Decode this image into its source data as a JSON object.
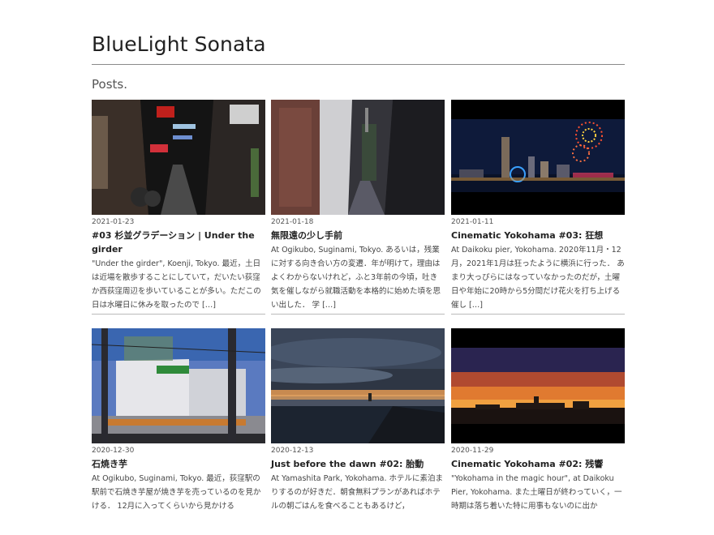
{
  "site": {
    "title": "BlueLight Sonata"
  },
  "section": {
    "heading": "Posts."
  },
  "posts": [
    {
      "date": "2021-01-23",
      "title": "#03 杉並グラデーション | Under the girder",
      "excerpt": "\"Under the girder\", Koenji, Tokyo. 最近，土日は近場を散歩することにしていて，だいたい荻窪か西荻窪周辺を歩いていることが多い。ただこの日は水曜日に休みを取ったので",
      "more": "[…]",
      "image": "night-alley-koenji"
    },
    {
      "date": "2021-01-18",
      "title": "無限遠の少し手前",
      "excerpt": "At Ogikubo, Suginami, Tokyo. あるいは，残業に対する向き合い方の変遷．年が明けて，理由はよくわからないけれど，ふと3年前の今頃，吐き気を催しながら就職活動を本格的に始めた頃を思い出した． 学",
      "more": "[…]",
      "image": "narrow-passage"
    },
    {
      "date": "2021-01-11",
      "title": "Cinematic Yokohama #03: 狂想",
      "excerpt": "At Daikoku pier, Yokohama. 2020年11月・12月，2021年1月は狂ったように横浜に行った． あまり大っぴらにはなっていなかったのだが，土曜日や年始に20時から5分間だけ花火を打ち上げる催し",
      "more": "[…]",
      "image": "yokohama-fireworks"
    },
    {
      "date": "2020-12-30",
      "title": "石焼き芋",
      "excerpt": "At Ogikubo, Suginami, Tokyo. 最近，荻窪駅の駅前で石焼き芋屋が焼き芋を売っているのを見かける． 12月に入ってくらいから見かける",
      "more": "",
      "image": "train-building"
    },
    {
      "date": "2020-12-13",
      "title": "Just before the dawn #02: 胎動",
      "excerpt": "At Yamashita Park, Yokohama. ホテルに素泊まりするのが好きだ．朝食無料プランがあればホテルの朝ごはんを食べることもあるけど，",
      "more": "",
      "image": "dawn-sea"
    },
    {
      "date": "2020-11-29",
      "title": "Cinematic Yokohama #02: 残響",
      "excerpt": "\"Yokohama in the magic hour\", at Daikoku Pier, Yokohama. また土曜日が終わっていく，一時期は落ち着いた特に用事もないのに出か",
      "more": "",
      "image": "yokohama-dusk"
    }
  ]
}
